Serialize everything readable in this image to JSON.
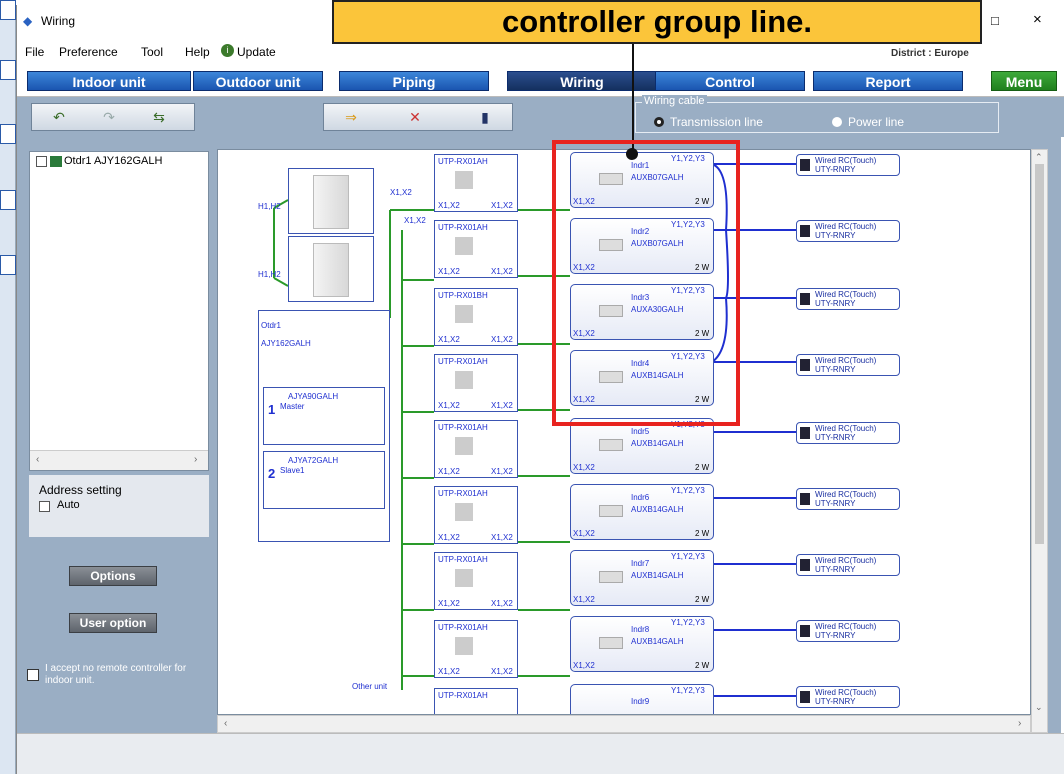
{
  "window": {
    "title": "Wiring",
    "district": "District : Europe",
    "controls": [
      "–",
      "□",
      "×"
    ]
  },
  "menubar": [
    "File",
    "Preference",
    "Tool",
    "Help",
    "Update"
  ],
  "tabs": [
    "Indoor unit",
    "Outdoor unit",
    "Piping",
    "Wiring",
    "Control",
    "Report",
    "Menu"
  ],
  "wiring_cable": {
    "legend": "Wiring cable",
    "options": [
      "Transmission line",
      "Power line"
    ],
    "selected": "Transmission line"
  },
  "tree": {
    "item": "Otdr1 AJY162GALH"
  },
  "address": {
    "title": "Address setting",
    "auto": "Auto"
  },
  "buttons": {
    "options": "Options",
    "user_option": "User option"
  },
  "accept_text": "I accept no remote controller for indoor unit.",
  "callout": "controller group line.",
  "outdoor": {
    "name": "Otdr1",
    "model": "AJY162GALH",
    "units": [
      {
        "n": "1",
        "model": "AJYA90GALH",
        "role": "Master"
      },
      {
        "n": "2",
        "model": "AJYA72GALH",
        "role": "Slave1"
      }
    ],
    "hlabel": "H1,H2",
    "xlabel": "X1,X2",
    "other": "Other unit"
  },
  "transmitters": [
    "UTP-RX01AH",
    "UTP-RX01AH",
    "UTP-RX01BH",
    "UTP-RX01AH",
    "UTP-RX01AH",
    "UTP-RX01AH",
    "UTP-RX01AH",
    "UTP-RX01AH",
    "UTP-RX01AH"
  ],
  "indoor": [
    {
      "name": "Indr1",
      "model": "AUXB07GALH"
    },
    {
      "name": "Indr2",
      "model": "AUXB07GALH"
    },
    {
      "name": "Indr3",
      "model": "AUXA30GALH"
    },
    {
      "name": "Indr4",
      "model": "AUXB14GALH"
    },
    {
      "name": "Indr5",
      "model": "AUXB14GALH"
    },
    {
      "name": "Indr6",
      "model": "AUXB14GALH"
    },
    {
      "name": "Indr7",
      "model": "AUXB14GALH"
    },
    {
      "name": "Indr8",
      "model": "AUXB14GALH"
    },
    {
      "name": "Indr9",
      "model": ""
    }
  ],
  "indoor_labels": {
    "y": "Y1,Y2,Y3",
    "x": "X1,X2",
    "w": "2 W"
  },
  "rc": {
    "title": "Wired RC(Touch)",
    "model": "UTY-RNRY"
  },
  "colors": {
    "tab": "#1a55b0",
    "active": "#14305f",
    "menu": "#20801e",
    "wire_green": "#2a9a2a",
    "wire_blue": "#1f2fd0",
    "highlight": "#e8231f",
    "callout": "#fbc53a"
  }
}
